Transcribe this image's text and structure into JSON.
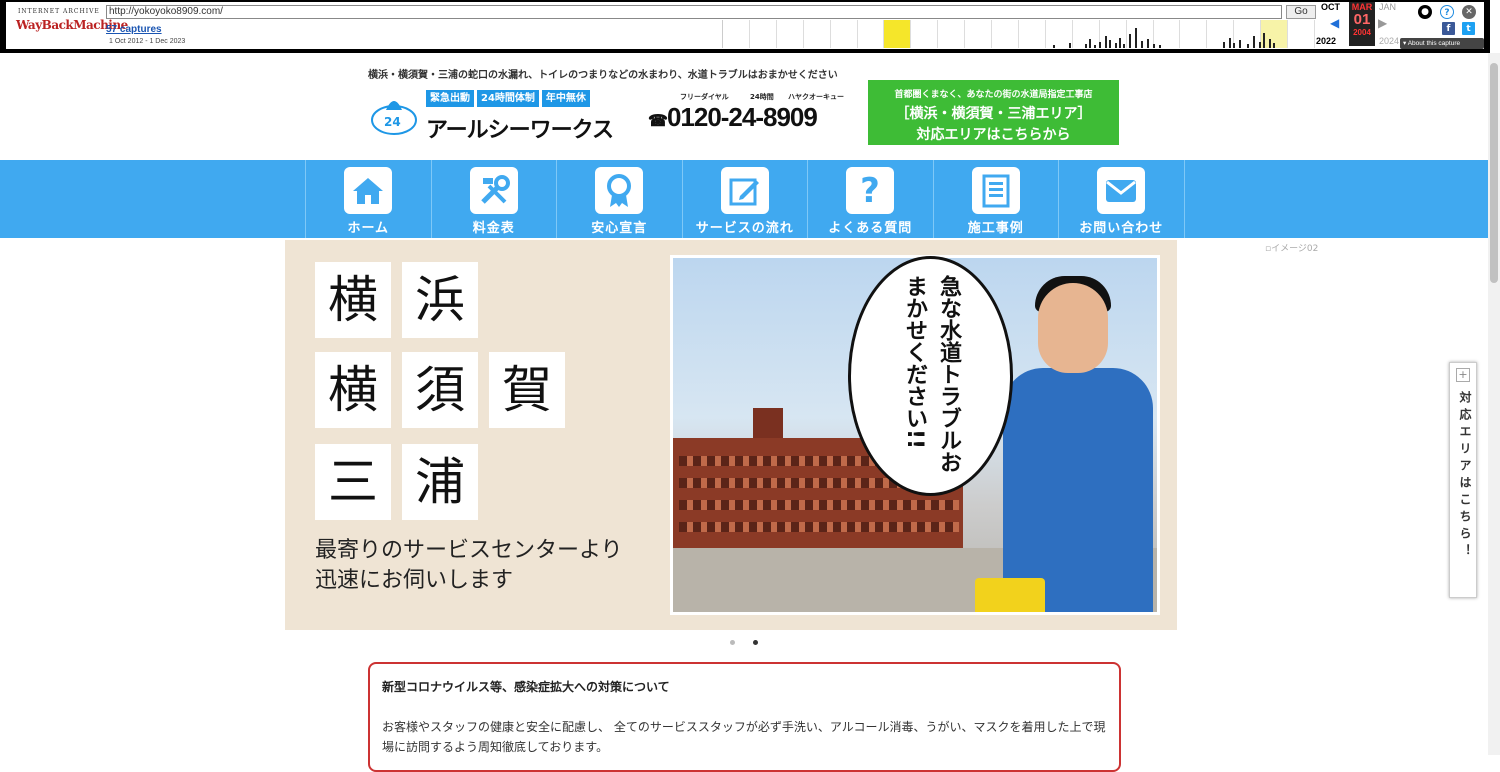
{
  "wayback": {
    "logo_top": "INTERNET ARCHIVE",
    "logo_main": "WayBackMachine",
    "url": "http://yokoyoko8909.com/",
    "go_label": "Go",
    "captures_link": "57 captures",
    "date_range": "1 Oct 2012 - 1 Dec 2023",
    "prev_month": "OCT",
    "cur_month": "MAR",
    "cur_day": "01",
    "cur_year": "2004",
    "next_month": "JAN",
    "prev_year": "2022",
    "next_year": "2024",
    "about": "▾ About this capture"
  },
  "site": {
    "tagline": "横浜・横須賀・三浦の蛇口の水漏れ、トイレのつまりなどの水まわり、水道トラブルはおまかせください",
    "badges": [
      "緊急出動",
      "24時間体制",
      "年中無休"
    ],
    "brand": "アールシーワークス",
    "phone_small_1": "フリーダイヤル",
    "phone_small_2": "24時間",
    "phone_small_3": "ハヤクオーキュー",
    "phone_number": "0120-24-8909",
    "area_line1": "首都圏くまなく、あなたの街の水道局指定工事店",
    "area_line2": "［横浜・横須賀・三浦エリア］",
    "area_line3": "対応エリアはこちらから"
  },
  "nav": [
    {
      "label": "ホーム",
      "icon": "home-icon"
    },
    {
      "label": "料金表",
      "icon": "tools-icon"
    },
    {
      "label": "安心宣言",
      "icon": "award-icon"
    },
    {
      "label": "サービスの流れ",
      "icon": "edit-icon"
    },
    {
      "label": "よくある質問",
      "icon": "question-icon"
    },
    {
      "label": "施工事例",
      "icon": "document-icon"
    },
    {
      "label": "お問い合わせ",
      "icon": "mail-icon"
    }
  ],
  "hero": {
    "kanji_row1": [
      "横",
      "浜"
    ],
    "kanji_row2": [
      "横",
      "須",
      "賀"
    ],
    "kanji_row3": [
      "三",
      "浦"
    ],
    "line1": "最寄りのサービスセンターより",
    "line2": "迅速にお伺いします",
    "bubble": "急な水道トラブルおまかせください!!",
    "broken_alt": "イメージ02"
  },
  "notice": {
    "title": "新型コロナウイルス等、感染症拡大への対策について",
    "body": "お客様やスタッフの健康と安全に配慮し、 全てのサービススタッフが必ず手洗い、アルコール消毒、うがい、マスクを着用した上で現場に訪問するよう周知徹底しております。"
  },
  "sidetab": {
    "plus": "+",
    "label": "対応エリアはこちら！"
  },
  "colors": {
    "nav_bg": "#40a9f0",
    "area_bg": "#3ebc36",
    "notice_border": "#cc3333"
  }
}
